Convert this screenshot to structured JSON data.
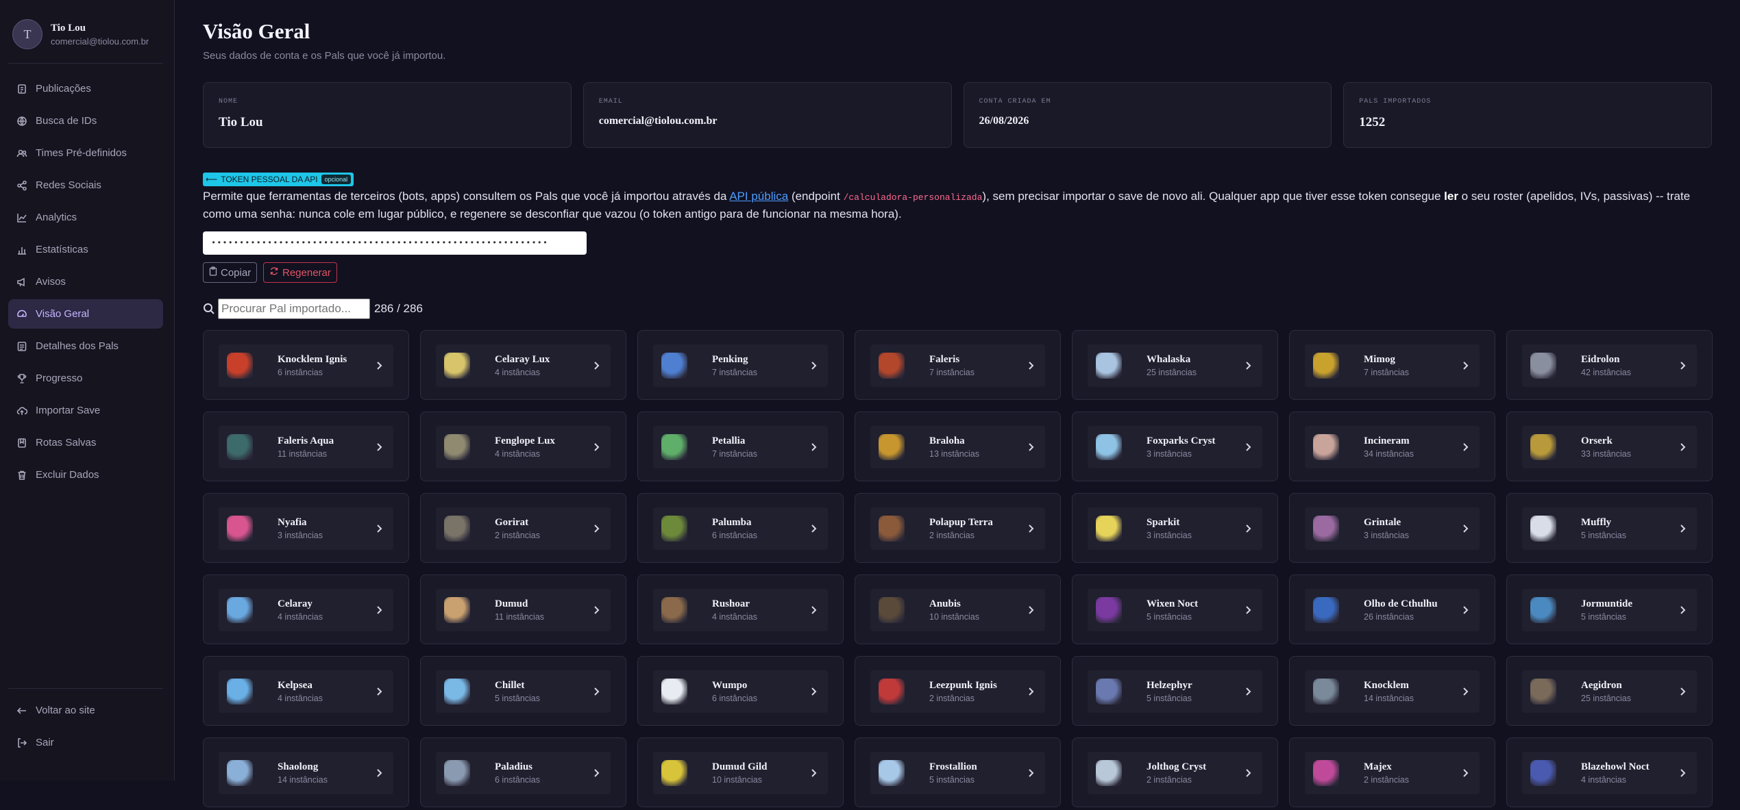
{
  "profile": {
    "initial": "T",
    "name": "Tio Lou",
    "email": "comercial@tiolou.com.br"
  },
  "nav": [
    {
      "id": "publicacoes",
      "label": "Publicações",
      "icon": "document-icon",
      "active": false
    },
    {
      "id": "busca-ids",
      "label": "Busca de IDs",
      "icon": "globe-icon",
      "active": false
    },
    {
      "id": "times",
      "label": "Times Pré-definidos",
      "icon": "users-icon",
      "active": false
    },
    {
      "id": "redes",
      "label": "Redes Sociais",
      "icon": "share-icon",
      "active": false
    },
    {
      "id": "analytics",
      "label": "Analytics",
      "icon": "line-chart-icon",
      "active": false
    },
    {
      "id": "estatisticas",
      "label": "Estatísticas",
      "icon": "bar-chart-icon",
      "active": false
    },
    {
      "id": "avisos",
      "label": "Avisos",
      "icon": "megaphone-icon",
      "active": false
    },
    {
      "id": "visao-geral",
      "label": "Visão Geral",
      "icon": "gauge-icon",
      "active": true
    },
    {
      "id": "detalhes",
      "label": "Detalhes dos Pals",
      "icon": "list-icon",
      "active": false
    },
    {
      "id": "progresso",
      "label": "Progresso",
      "icon": "trophy-icon",
      "active": false
    },
    {
      "id": "importar",
      "label": "Importar Save",
      "icon": "cloud-upload-icon",
      "active": false
    },
    {
      "id": "rotas",
      "label": "Rotas Salvas",
      "icon": "bookmark-icon",
      "active": false
    },
    {
      "id": "excluir",
      "label": "Excluir Dados",
      "icon": "trash-icon",
      "active": false
    }
  ],
  "nav_bottom": [
    {
      "id": "voltar",
      "label": "Voltar ao site",
      "icon": "arrow-left-icon"
    },
    {
      "id": "sair",
      "label": "Sair",
      "icon": "logout-icon"
    }
  ],
  "header": {
    "title": "Visão Geral",
    "subtitle": "Seus dados de conta e os Pals que você já importou."
  },
  "stats": [
    {
      "id": "nome",
      "label": "NOME",
      "value": "Tio Lou"
    },
    {
      "id": "email",
      "label": "EMAIL",
      "value": "comercial@tiolou.com.br"
    },
    {
      "id": "conta",
      "label": "CONTA CRIADA EM",
      "value": "26/08/2026"
    },
    {
      "id": "pals",
      "label": "PALS IMPORTADOS",
      "value": "1252"
    }
  ],
  "token": {
    "badge": "TOKEN PESSOAL DA API",
    "optional": "opcional",
    "desc_1": "Permite que ferramentas de terceiros (bots, apps) consultem os Pals que você já importou através da ",
    "link": "API pública",
    "desc_2": " (endpoint ",
    "endpoint": "/calculadora-personalizada",
    "desc_3": "), sem precisar importar o save de novo ali. Qualquer app que tiver esse token consegue ",
    "bold": "ler",
    "desc_4": " o seu roster (apelidos, IVs, passivas) -- trate como uma senha: nunca cole em lugar público, e regenere se desconfiar que vazou (o token antigo para de funcionar na mesma hora).",
    "value": "••••••••••••••••••••••••••••••••••••••••••••••••••••••••••••",
    "copy_label": "Copiar",
    "regen_label": "Regenerar"
  },
  "search": {
    "placeholder": "Procurar Pal importado...",
    "count": "286 / 286"
  },
  "pals": [
    {
      "name": "Knocklem Ignis",
      "count": "6 instâncias",
      "color": "#c8402a"
    },
    {
      "name": "Celaray Lux",
      "count": "4 instâncias",
      "color": "#d8c46a"
    },
    {
      "name": "Penking",
      "count": "7 instâncias",
      "color": "#4f7fd0"
    },
    {
      "name": "Faleris",
      "count": "7 instâncias",
      "color": "#b3472b"
    },
    {
      "name": "Whalaska",
      "count": "25 instâncias",
      "color": "#a9c4e0"
    },
    {
      "name": "Mimog",
      "count": "7 instâncias",
      "color": "#c9a22e"
    },
    {
      "name": "Eidrolon",
      "count": "42 instâncias",
      "color": "#8a8fa0"
    },
    {
      "name": "Faleris Aqua",
      "count": "11 instâncias",
      "color": "#3d6a6a"
    },
    {
      "name": "Fenglope Lux",
      "count": "4 instâncias",
      "color": "#8f8a70"
    },
    {
      "name": "Petallia",
      "count": "7 instâncias",
      "color": "#5fae6a"
    },
    {
      "name": "Braloha",
      "count": "13 instâncias",
      "color": "#c7962f"
    },
    {
      "name": "Foxparks Cryst",
      "count": "3 instâncias",
      "color": "#8fc3e6"
    },
    {
      "name": "Incineram",
      "count": "34 instâncias",
      "color": "#c9a49a"
    },
    {
      "name": "Orserk",
      "count": "33 instâncias",
      "color": "#b89a3a"
    },
    {
      "name": "Nyafia",
      "count": "3 instâncias",
      "color": "#d8558f"
    },
    {
      "name": "Gorirat",
      "count": "2 instâncias",
      "color": "#7a7468"
    },
    {
      "name": "Palumba",
      "count": "6 instâncias",
      "color": "#6c8a3a"
    },
    {
      "name": "Polapup Terra",
      "count": "2 instâncias",
      "color": "#8a5a3a"
    },
    {
      "name": "Sparkit",
      "count": "3 instâncias",
      "color": "#e6d35a"
    },
    {
      "name": "Grintale",
      "count": "3 instâncias",
      "color": "#9a6aa0"
    },
    {
      "name": "Muffly",
      "count": "5 instâncias",
      "color": "#d8dde8"
    },
    {
      "name": "Celaray",
      "count": "4 instâncias",
      "color": "#6aa8e0"
    },
    {
      "name": "Dumud",
      "count": "11 instâncias",
      "color": "#c9a070"
    },
    {
      "name": "Rushoar",
      "count": "4 instâncias",
      "color": "#8a6a4a"
    },
    {
      "name": "Anubis",
      "count": "10 instâncias",
      "color": "#5a4a3a"
    },
    {
      "name": "Wixen Noct",
      "count": "5 instâncias",
      "color": "#7a3aa0"
    },
    {
      "name": "Olho de Cthulhu",
      "count": "26 instâncias",
      "color": "#3a6ac0"
    },
    {
      "name": "Jormuntide",
      "count": "5 instâncias",
      "color": "#4a8ac0"
    },
    {
      "name": "Kelpsea",
      "count": "4 instâncias",
      "color": "#6ab0e6"
    },
    {
      "name": "Chillet",
      "count": "5 instâncias",
      "color": "#7ab8e6"
    },
    {
      "name": "Wumpo",
      "count": "6 instâncias",
      "color": "#e8ecf2"
    },
    {
      "name": "Leezpunk Ignis",
      "count": "2 instâncias",
      "color": "#c03a3a"
    },
    {
      "name": "Helzephyr",
      "count": "5 instâncias",
      "color": "#6a7ab0"
    },
    {
      "name": "Knocklem",
      "count": "14 instâncias",
      "color": "#7a8a9a"
    },
    {
      "name": "Aegidron",
      "count": "25 instâncias",
      "color": "#7a6a5a"
    },
    {
      "name": "Shaolong",
      "count": "14 instâncias",
      "color": "#8ab0d8"
    },
    {
      "name": "Paladius",
      "count": "6 instâncias",
      "color": "#8a9ab0"
    },
    {
      "name": "Dumud Gild",
      "count": "10 instâncias",
      "color": "#d8c43a"
    },
    {
      "name": "Frostallion",
      "count": "5 instâncias",
      "color": "#a8c8e8"
    },
    {
      "name": "Jolthog Cryst",
      "count": "2 instâncias",
      "color": "#b8c8d8"
    },
    {
      "name": "Majex",
      "count": "2 instâncias",
      "color": "#c04a9a"
    },
    {
      "name": "Blazehowl Noct",
      "count": "4 instâncias",
      "color": "#4a5ab0"
    }
  ]
}
